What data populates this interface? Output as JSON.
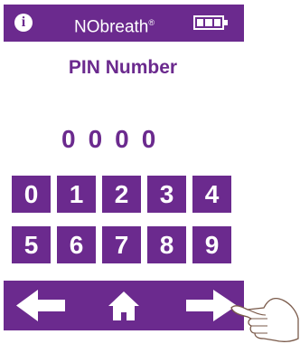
{
  "header": {
    "info_icon_glyph": "i",
    "brand_name": "NObreath",
    "brand_mark": "®",
    "battery_level": 1.0
  },
  "pin": {
    "title": "PIN Number",
    "value": "0000"
  },
  "keypad": {
    "keys": [
      "0",
      "1",
      "2",
      "3",
      "4",
      "5",
      "6",
      "7",
      "8",
      "9"
    ]
  },
  "nav": {
    "back_icon": "arrow-left-icon",
    "home_icon": "home-icon",
    "next_icon": "arrow-right-icon"
  },
  "colors": {
    "brand_purple": "#6b2a8e",
    "foreground": "#ffffff"
  }
}
